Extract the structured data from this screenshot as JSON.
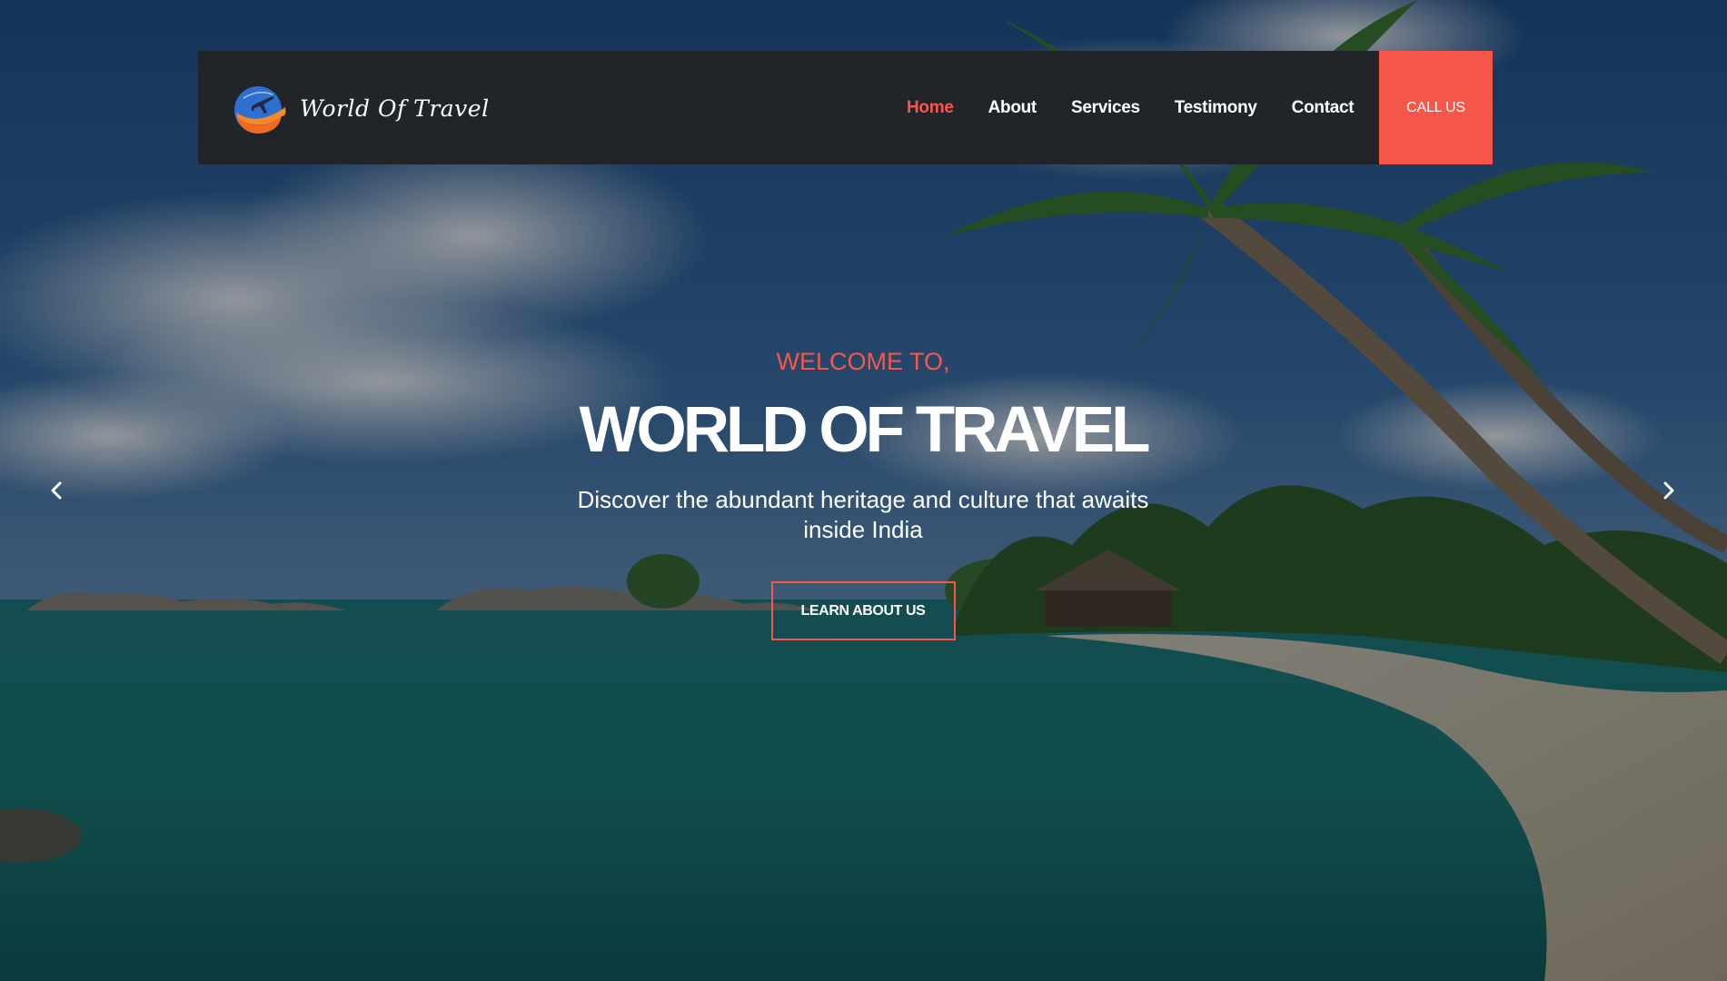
{
  "brand": {
    "name": "World Of Travel",
    "logo_icon": "globe-plane-icon"
  },
  "nav": {
    "items": [
      {
        "label": "Home",
        "active": true
      },
      {
        "label": "About",
        "active": false
      },
      {
        "label": "Services",
        "active": false
      },
      {
        "label": "Testimony",
        "active": false
      },
      {
        "label": "Contact",
        "active": false
      }
    ],
    "call_label": "CALL US"
  },
  "hero": {
    "kicker": "WELCOME TO,",
    "title": "WORLD OF TRAVEL",
    "description": "Discover the abundant heritage and culture that awaits inside India",
    "button_label": "LEARN ABOUT US",
    "prev_icon": "chevron-left-icon",
    "next_icon": "chevron-right-icon",
    "background": "tropical-beach-photo"
  },
  "colors": {
    "accent": "#f7564b",
    "navbar_bg": "#212529",
    "text": "#ffffff"
  }
}
